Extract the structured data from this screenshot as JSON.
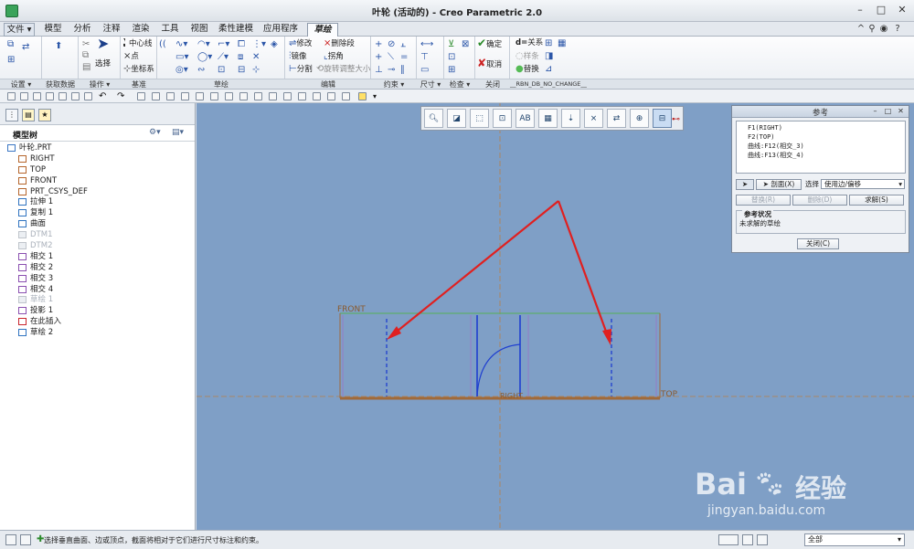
{
  "window": {
    "title": "叶轮 (活动的) - Creo Parametric 2.0",
    "controls": [
      "–",
      "□",
      "✕"
    ]
  },
  "menu_tabs": [
    {
      "label": "文件 ▾",
      "kind": "file"
    },
    {
      "label": "模型"
    },
    {
      "label": "分析"
    },
    {
      "label": "注释"
    },
    {
      "label": "渲染"
    },
    {
      "label": "工具"
    },
    {
      "label": "视图"
    },
    {
      "label": "柔性建模"
    },
    {
      "label": "应用程序"
    },
    {
      "label": "草绘",
      "kind": "active"
    }
  ],
  "ribbon": {
    "operate": {
      "cut": "",
      "select": "选择"
    },
    "datum": {
      "centerline": "中心线",
      "point": "点",
      "csys": "坐标系"
    },
    "edit": {
      "modify": "修改",
      "delete_segment": "删除段",
      "mirror": "镜像",
      "corner": "拐角",
      "divide": "分割",
      "rotate_resize": "旋转调整大小"
    },
    "close": {
      "ok": "确定",
      "cancel": "取消"
    },
    "relations": {
      "relation": "关系",
      "sample": "样条",
      "replace": "替换"
    }
  },
  "group_labels": [
    "设置 ▾",
    "获取数据",
    "操作 ▾",
    "基准",
    "草绘",
    "编辑",
    "约束 ▾",
    "尺寸 ▾",
    "检查 ▾",
    "关闭",
    "__RBN_DB_NO_CHANGE__"
  ],
  "model_tree": {
    "header": "模型树",
    "items": [
      {
        "label": "叶轮.PRT",
        "icon": "part-icon",
        "indent": 0,
        "dim": false,
        "color": "#3a76c4"
      },
      {
        "label": "RIGHT",
        "icon": "datum-plane-icon",
        "indent": 1,
        "dim": false,
        "color": "#b5652b"
      },
      {
        "label": "TOP",
        "icon": "datum-plane-icon",
        "indent": 1,
        "dim": false,
        "color": "#b5652b"
      },
      {
        "label": "FRONT",
        "icon": "datum-plane-icon",
        "indent": 1,
        "dim": false,
        "color": "#b5652b"
      },
      {
        "label": "PRT_CSYS_DEF",
        "icon": "csys-icon",
        "indent": 1,
        "dim": false,
        "color": "#b5652b"
      },
      {
        "label": "拉伸 1",
        "icon": "extrude-icon",
        "indent": 1,
        "dim": false,
        "color": "#2f73c0"
      },
      {
        "label": "复制 1",
        "icon": "copy-icon",
        "indent": 1,
        "dim": false,
        "color": "#2f73c0"
      },
      {
        "label": "曲面",
        "icon": "surface-icon",
        "indent": 1,
        "dim": false,
        "color": "#2f73c0"
      },
      {
        "label": "DTM1",
        "icon": "datum-plane-icon",
        "indent": 1,
        "dim": true,
        "color": "#bfc4cb"
      },
      {
        "label": "DTM2",
        "icon": "datum-plane-icon",
        "indent": 1,
        "dim": true,
        "color": "#bfc4cb"
      },
      {
        "label": "相交 1",
        "icon": "intersect-icon",
        "indent": 1,
        "dim": false,
        "color": "#8a4fb0"
      },
      {
        "label": "相交 2",
        "icon": "intersect-icon",
        "indent": 1,
        "dim": false,
        "color": "#8a4fb0"
      },
      {
        "label": "相交 3",
        "icon": "intersect-icon",
        "indent": 1,
        "dim": false,
        "color": "#8a4fb0"
      },
      {
        "label": "相交 4",
        "icon": "intersect-icon",
        "indent": 1,
        "dim": false,
        "color": "#8a4fb0"
      },
      {
        "label": "草绘 1",
        "icon": "sketch-icon",
        "indent": 1,
        "dim": true,
        "color": "#bfc4cb"
      },
      {
        "label": "投影 1",
        "icon": "project-icon",
        "indent": 1,
        "dim": false,
        "color": "#8a4fb0"
      },
      {
        "label": "在此插入",
        "icon": "insert-here-icon",
        "indent": 1,
        "dim": false,
        "color": "#c8242c"
      },
      {
        "label": "草绘 2",
        "icon": "sketch-icon",
        "indent": 1,
        "dim": false,
        "color": "#2f73c0"
      }
    ]
  },
  "reference_dialog": {
    "title": "参考",
    "references": [
      "F1(RIGHT)",
      "F2(TOP)",
      "曲线:F12(相交_3)",
      "曲线:F13(相交_4)"
    ],
    "section_button": "剖面(X)",
    "select_label": "选择",
    "select_value": "使用边/偏移",
    "replace_button": "替换(R)",
    "delete_button": "删除(D)",
    "solve_button": "求解(S)",
    "status_heading": "参考状况",
    "status_text": "未求解的草绘",
    "close_button": "关闭(C)"
  },
  "sketch_labels": {
    "front": "FRONT",
    "top": "TOP",
    "right": "RIGHT"
  },
  "status": {
    "message": "选择垂直曲面、边或顶点，截面将相对于它们进行尺寸标注和约束。",
    "filter": "全部"
  },
  "watermark": {
    "brand": "Bai",
    "suffix": "经验",
    "url": "jingyan.baidu.com"
  },
  "colors": {
    "canvas": "#7f9fc6",
    "arrow": "#e02020",
    "sketch_line": "#1f3fd0",
    "datum": "#a06a3a"
  }
}
